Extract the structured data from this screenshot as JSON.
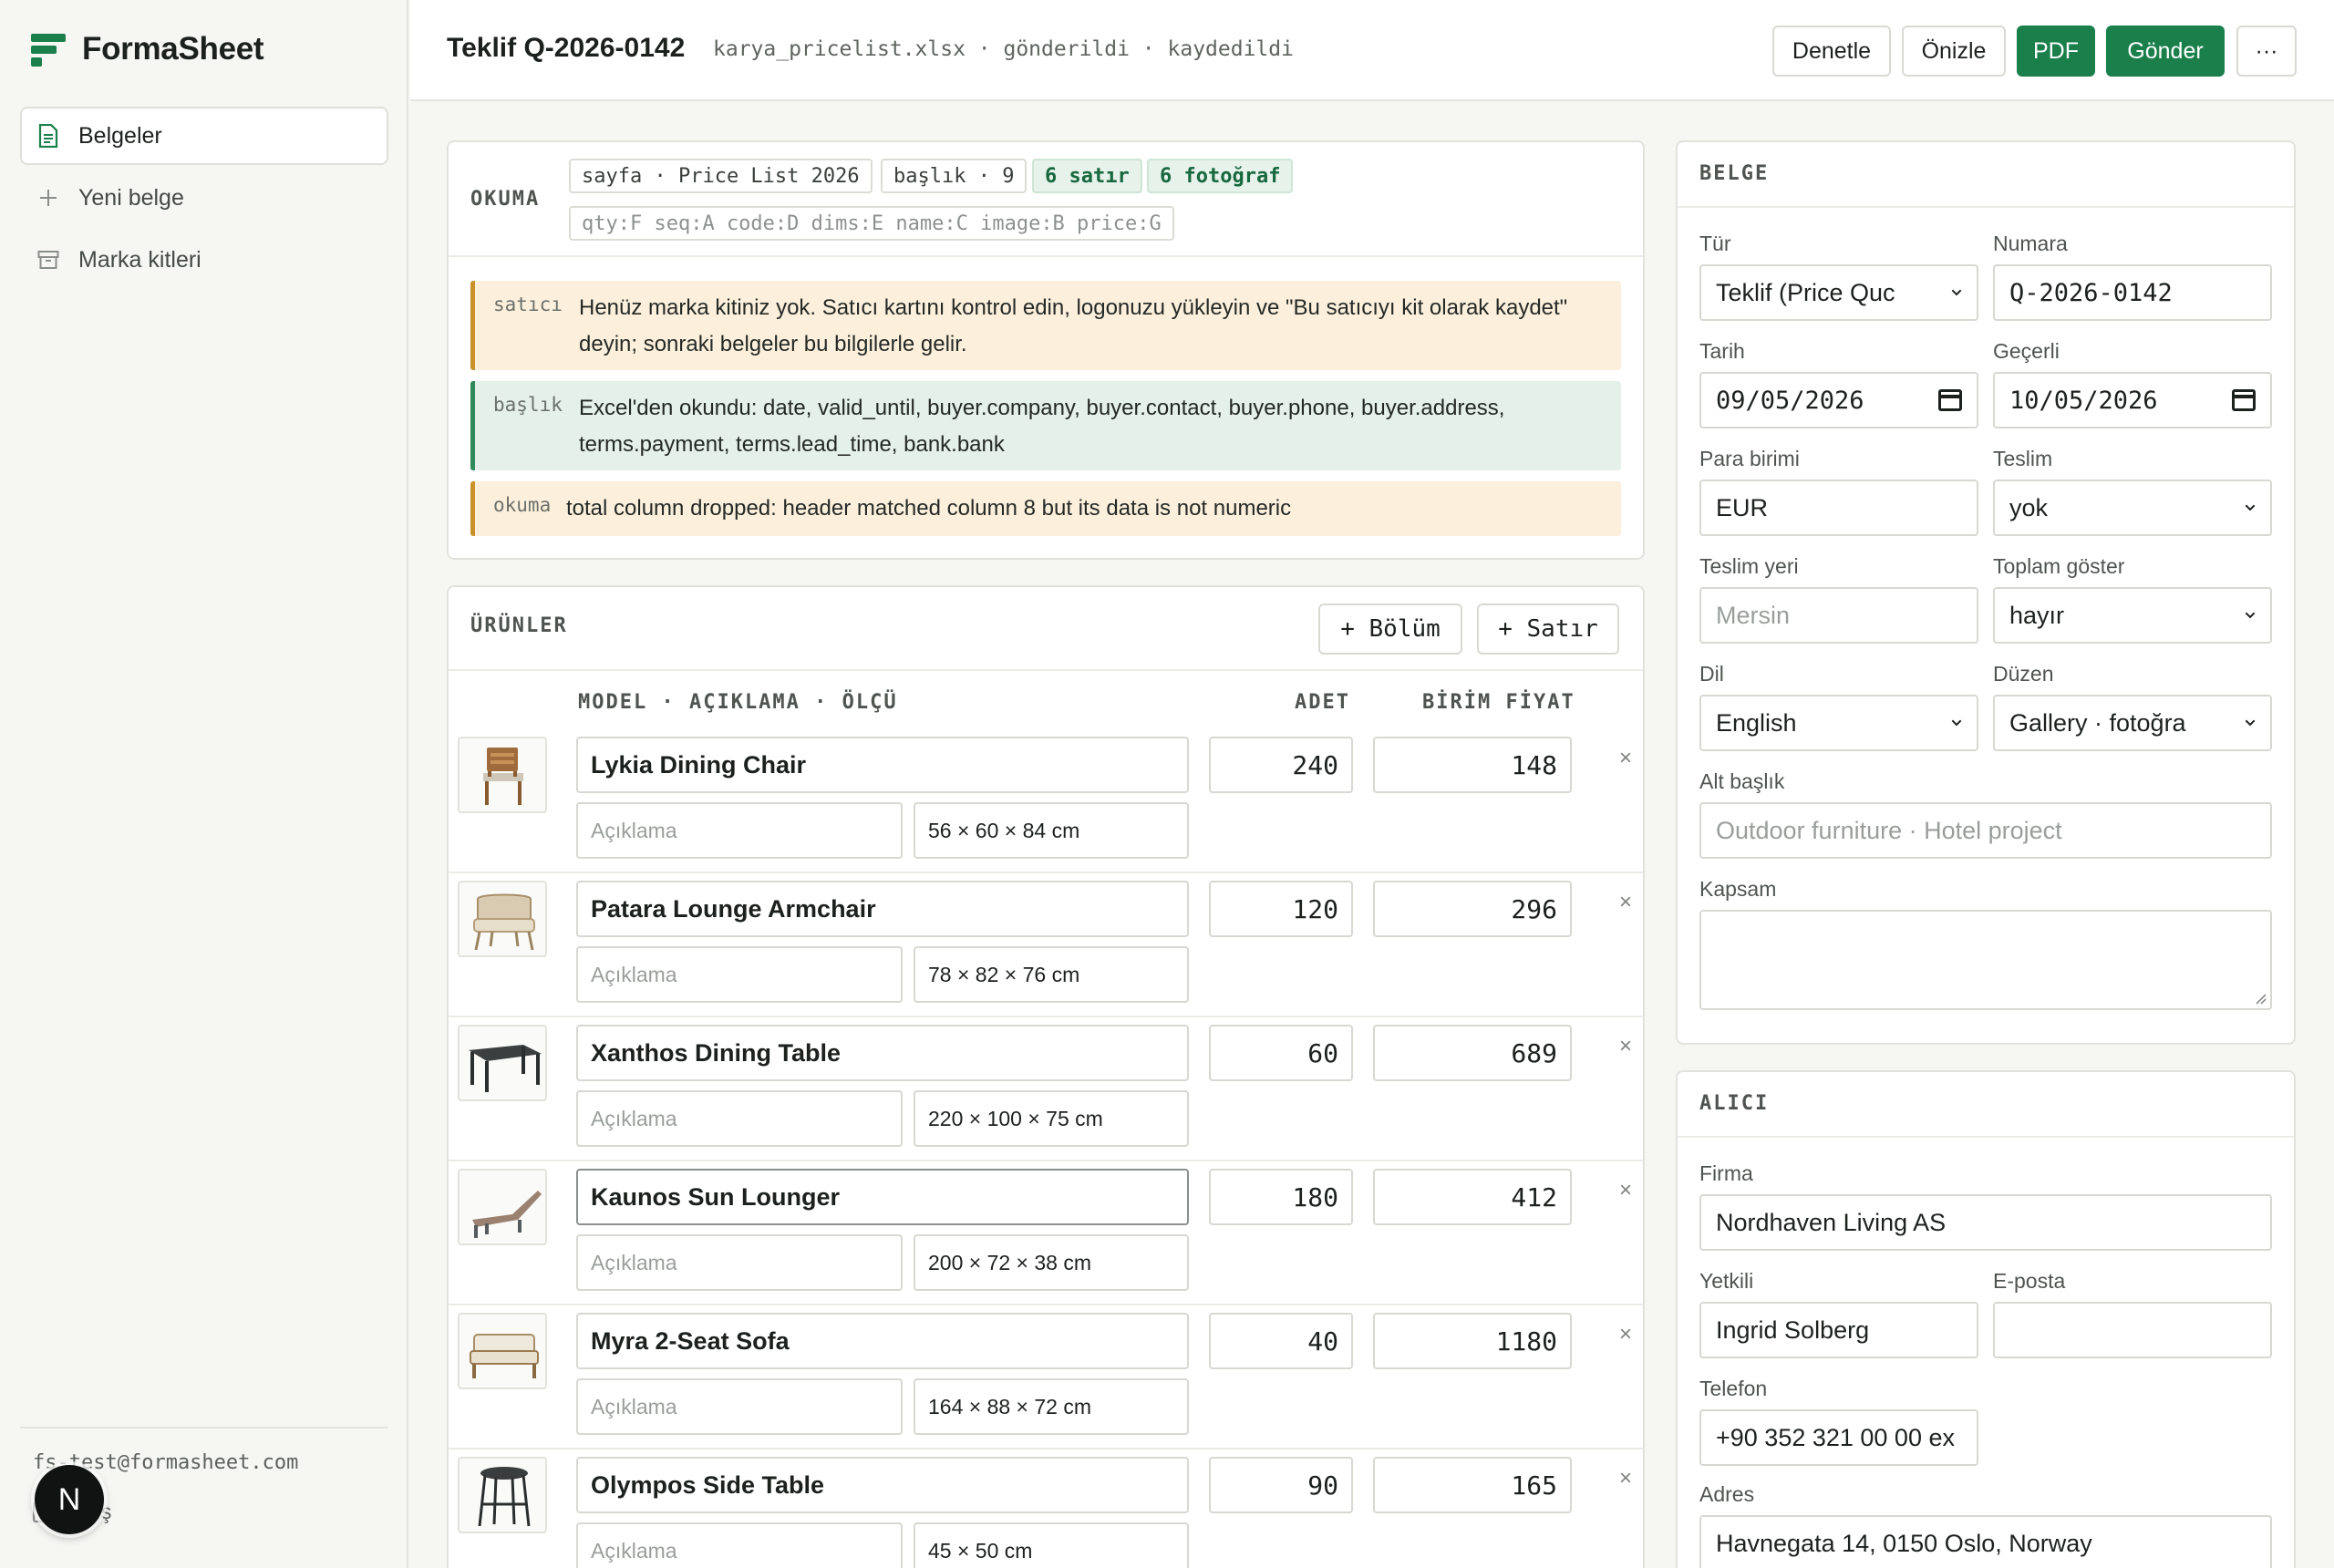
{
  "brand": {
    "name": "FormaSheet"
  },
  "nav": {
    "items": [
      {
        "label": "Belgeler",
        "icon": "document-icon",
        "active": true
      },
      {
        "label": "Yeni belge",
        "icon": "plus-icon",
        "active": false
      },
      {
        "label": "Marka kitleri",
        "icon": "archive-icon",
        "active": false
      }
    ]
  },
  "user": {
    "email": "fs-test@formasheet.com",
    "logout": "Çıkış",
    "avatar_letter": "N"
  },
  "topbar": {
    "title": "Teklif Q-2026-0142",
    "meta": "karya_pricelist.xlsx · gönderildi · kaydedildi",
    "buttons": {
      "check": "Denetle",
      "preview": "Önizle",
      "pdf": "PDF",
      "send": "Gönder",
      "more": "···"
    }
  },
  "reading": {
    "label": "OKUMA",
    "chips": {
      "sheet": "sayfa · Price List 2026",
      "header": "başlık · 9",
      "rows": "6 satır",
      "photos": "6 fotoğraf",
      "mapping": "qty:F seq:A code:D dims:E name:C image:B price:G"
    },
    "notes": [
      {
        "tag": "satıcı",
        "text": "Henüz marka kitiniz yok. Satıcı kartını kontrol edin, logonuzu yükleyin ve \"Bu satıcıyı kit olarak kaydet\" deyin; sonraki belgeler bu bilgilerle gelir.",
        "tone": "amber"
      },
      {
        "tag": "başlık",
        "text": "Excel'den okundu: date, valid_until, buyer.company, buyer.contact, buyer.phone, buyer.address, terms.payment, terms.lead_time, bank.bank",
        "tone": "green"
      },
      {
        "tag": "okuma",
        "text": "total column dropped: header matched column 8 but its data is not numeric",
        "tone": "amber"
      }
    ]
  },
  "products": {
    "label": "ÜRÜNLER",
    "add_section": "+ Bölüm",
    "add_row": "+ Satır",
    "columns": {
      "model": "MODEL · AÇIKLAMA · ÖLÇÜ",
      "qty": "ADET",
      "price": "BİRİM FİYAT"
    },
    "description_placeholder": "Açıklama",
    "remove": "×",
    "rows": [
      {
        "name": "Lykia Dining Chair",
        "dims": "56 × 60 × 84 cm",
        "qty": "240",
        "price": "148",
        "thumb": "chair-thumb"
      },
      {
        "name": "Patara Lounge Armchair",
        "dims": "78 × 82 × 76 cm",
        "qty": "120",
        "price": "296",
        "thumb": "armchair-thumb"
      },
      {
        "name": "Xanthos Dining Table",
        "dims": "220 × 100 × 75 cm",
        "qty": "60",
        "price": "689",
        "thumb": "table-thumb"
      },
      {
        "name": "Kaunos Sun Lounger",
        "dims": "200 × 72 × 38 cm",
        "qty": "180",
        "price": "412",
        "thumb": "lounger-thumb"
      },
      {
        "name": "Myra 2-Seat Sofa",
        "dims": "164 × 88 × 72 cm",
        "qty": "40",
        "price": "1180",
        "thumb": "sofa-thumb"
      },
      {
        "name": "Olympos Side Table",
        "dims": "45 × 50 cm",
        "qty": "90",
        "price": "165",
        "thumb": "side-table-thumb"
      }
    ]
  },
  "document": {
    "label": "BELGE",
    "type": {
      "label": "Tür",
      "value": "Teklif (Price Quc"
    },
    "number": {
      "label": "Numara",
      "value": "Q-2026-0142"
    },
    "date": {
      "label": "Tarih",
      "value": "09/05/2026"
    },
    "valid": {
      "label": "Geçerli",
      "value": "10/05/2026"
    },
    "currency": {
      "label": "Para birimi",
      "value": "EUR"
    },
    "delivery": {
      "label": "Teslim",
      "value": "yok"
    },
    "delivery_place": {
      "label": "Teslim yeri",
      "placeholder": "Mersin"
    },
    "show_total": {
      "label": "Toplam göster",
      "value": "hayır"
    },
    "language": {
      "label": "Dil",
      "value": "English"
    },
    "layout": {
      "label": "Düzen",
      "value": "Gallery · fotoğra"
    },
    "subtitle": {
      "label": "Alt başlık",
      "placeholder": "Outdoor furniture · Hotel project"
    },
    "scope": {
      "label": "Kapsam",
      "value": ""
    }
  },
  "buyer": {
    "label": "ALICI",
    "company": {
      "label": "Firma",
      "value": "Nordhaven Living AS"
    },
    "contact": {
      "label": "Yetkili",
      "value": "Ingrid Solberg"
    },
    "email": {
      "label": "E-posta",
      "value": ""
    },
    "phone": {
      "label": "Telefon",
      "value": "+90 352 321 00 00 ex"
    },
    "address": {
      "label": "Adres",
      "value": "Havnegata 14, 0150 Oslo, Norway"
    }
  },
  "colors": {
    "accent": "#1a7f4b",
    "amber_note": "#fcf0dc",
    "green_note": "#e4f0e9"
  }
}
